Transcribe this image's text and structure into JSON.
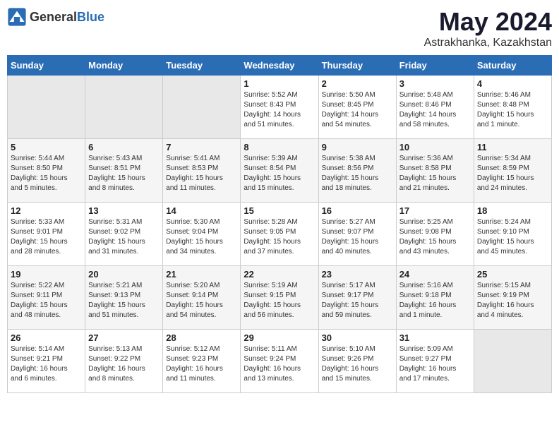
{
  "header": {
    "logo_general": "General",
    "logo_blue": "Blue",
    "title": "May 2024",
    "subtitle": "Astrakhanka, Kazakhstan"
  },
  "calendar": {
    "days_of_week": [
      "Sunday",
      "Monday",
      "Tuesday",
      "Wednesday",
      "Thursday",
      "Friday",
      "Saturday"
    ],
    "weeks": [
      [
        {
          "num": "",
          "info": ""
        },
        {
          "num": "",
          "info": ""
        },
        {
          "num": "",
          "info": ""
        },
        {
          "num": "1",
          "info": "Sunrise: 5:52 AM\nSunset: 8:43 PM\nDaylight: 14 hours\nand 51 minutes."
        },
        {
          "num": "2",
          "info": "Sunrise: 5:50 AM\nSunset: 8:45 PM\nDaylight: 14 hours\nand 54 minutes."
        },
        {
          "num": "3",
          "info": "Sunrise: 5:48 AM\nSunset: 8:46 PM\nDaylight: 14 hours\nand 58 minutes."
        },
        {
          "num": "4",
          "info": "Sunrise: 5:46 AM\nSunset: 8:48 PM\nDaylight: 15 hours\nand 1 minute."
        }
      ],
      [
        {
          "num": "5",
          "info": "Sunrise: 5:44 AM\nSunset: 8:50 PM\nDaylight: 15 hours\nand 5 minutes."
        },
        {
          "num": "6",
          "info": "Sunrise: 5:43 AM\nSunset: 8:51 PM\nDaylight: 15 hours\nand 8 minutes."
        },
        {
          "num": "7",
          "info": "Sunrise: 5:41 AM\nSunset: 8:53 PM\nDaylight: 15 hours\nand 11 minutes."
        },
        {
          "num": "8",
          "info": "Sunrise: 5:39 AM\nSunset: 8:54 PM\nDaylight: 15 hours\nand 15 minutes."
        },
        {
          "num": "9",
          "info": "Sunrise: 5:38 AM\nSunset: 8:56 PM\nDaylight: 15 hours\nand 18 minutes."
        },
        {
          "num": "10",
          "info": "Sunrise: 5:36 AM\nSunset: 8:58 PM\nDaylight: 15 hours\nand 21 minutes."
        },
        {
          "num": "11",
          "info": "Sunrise: 5:34 AM\nSunset: 8:59 PM\nDaylight: 15 hours\nand 24 minutes."
        }
      ],
      [
        {
          "num": "12",
          "info": "Sunrise: 5:33 AM\nSunset: 9:01 PM\nDaylight: 15 hours\nand 28 minutes."
        },
        {
          "num": "13",
          "info": "Sunrise: 5:31 AM\nSunset: 9:02 PM\nDaylight: 15 hours\nand 31 minutes."
        },
        {
          "num": "14",
          "info": "Sunrise: 5:30 AM\nSunset: 9:04 PM\nDaylight: 15 hours\nand 34 minutes."
        },
        {
          "num": "15",
          "info": "Sunrise: 5:28 AM\nSunset: 9:05 PM\nDaylight: 15 hours\nand 37 minutes."
        },
        {
          "num": "16",
          "info": "Sunrise: 5:27 AM\nSunset: 9:07 PM\nDaylight: 15 hours\nand 40 minutes."
        },
        {
          "num": "17",
          "info": "Sunrise: 5:25 AM\nSunset: 9:08 PM\nDaylight: 15 hours\nand 43 minutes."
        },
        {
          "num": "18",
          "info": "Sunrise: 5:24 AM\nSunset: 9:10 PM\nDaylight: 15 hours\nand 45 minutes."
        }
      ],
      [
        {
          "num": "19",
          "info": "Sunrise: 5:22 AM\nSunset: 9:11 PM\nDaylight: 15 hours\nand 48 minutes."
        },
        {
          "num": "20",
          "info": "Sunrise: 5:21 AM\nSunset: 9:13 PM\nDaylight: 15 hours\nand 51 minutes."
        },
        {
          "num": "21",
          "info": "Sunrise: 5:20 AM\nSunset: 9:14 PM\nDaylight: 15 hours\nand 54 minutes."
        },
        {
          "num": "22",
          "info": "Sunrise: 5:19 AM\nSunset: 9:15 PM\nDaylight: 15 hours\nand 56 minutes."
        },
        {
          "num": "23",
          "info": "Sunrise: 5:17 AM\nSunset: 9:17 PM\nDaylight: 15 hours\nand 59 minutes."
        },
        {
          "num": "24",
          "info": "Sunrise: 5:16 AM\nSunset: 9:18 PM\nDaylight: 16 hours\nand 1 minute."
        },
        {
          "num": "25",
          "info": "Sunrise: 5:15 AM\nSunset: 9:19 PM\nDaylight: 16 hours\nand 4 minutes."
        }
      ],
      [
        {
          "num": "26",
          "info": "Sunrise: 5:14 AM\nSunset: 9:21 PM\nDaylight: 16 hours\nand 6 minutes."
        },
        {
          "num": "27",
          "info": "Sunrise: 5:13 AM\nSunset: 9:22 PM\nDaylight: 16 hours\nand 8 minutes."
        },
        {
          "num": "28",
          "info": "Sunrise: 5:12 AM\nSunset: 9:23 PM\nDaylight: 16 hours\nand 11 minutes."
        },
        {
          "num": "29",
          "info": "Sunrise: 5:11 AM\nSunset: 9:24 PM\nDaylight: 16 hours\nand 13 minutes."
        },
        {
          "num": "30",
          "info": "Sunrise: 5:10 AM\nSunset: 9:26 PM\nDaylight: 16 hours\nand 15 minutes."
        },
        {
          "num": "31",
          "info": "Sunrise: 5:09 AM\nSunset: 9:27 PM\nDaylight: 16 hours\nand 17 minutes."
        },
        {
          "num": "",
          "info": ""
        }
      ]
    ]
  }
}
